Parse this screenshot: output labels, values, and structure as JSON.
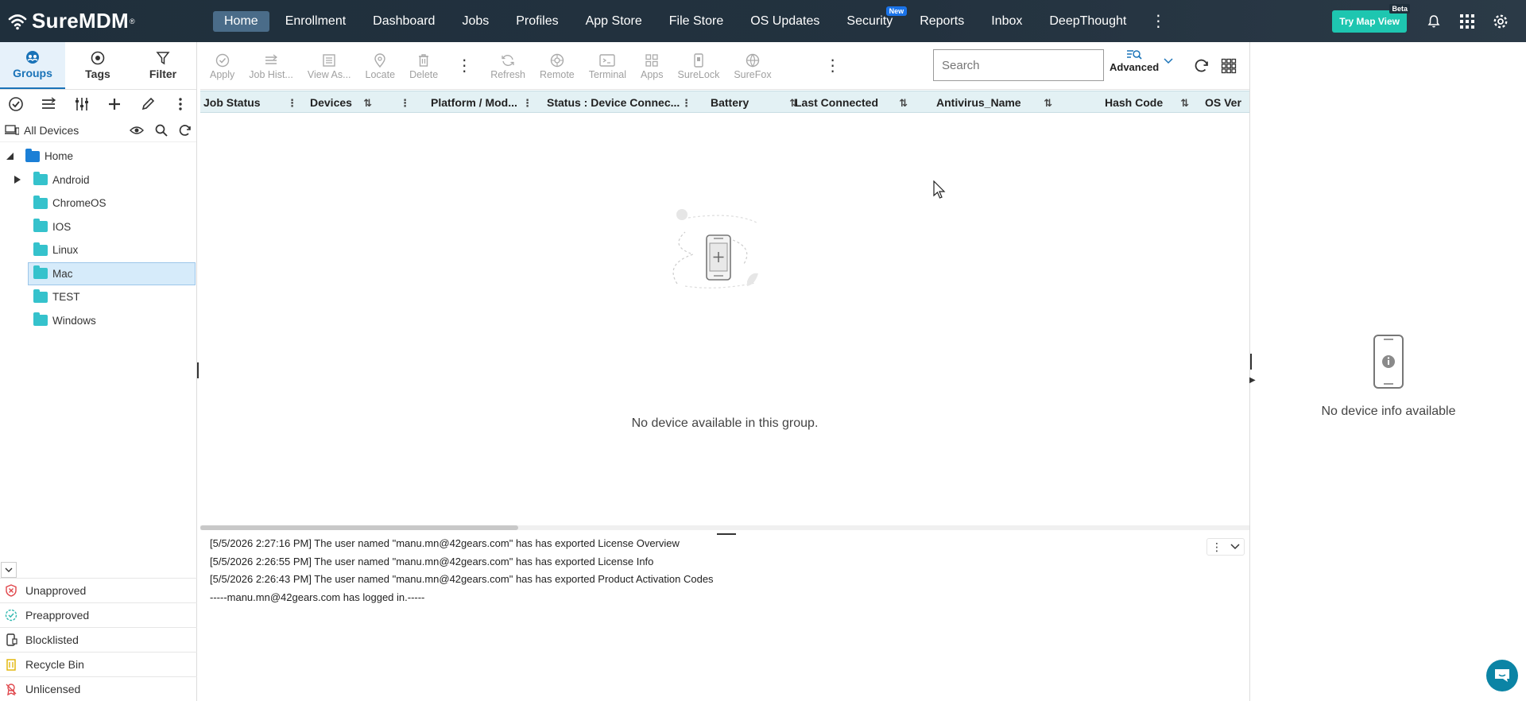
{
  "app": {
    "name": "SureMDM",
    "reg": "®"
  },
  "nav": {
    "items": [
      {
        "label": "Home",
        "active": true
      },
      {
        "label": "Enrollment"
      },
      {
        "label": "Dashboard"
      },
      {
        "label": "Jobs"
      },
      {
        "label": "Profiles"
      },
      {
        "label": "App Store"
      },
      {
        "label": "File Store"
      },
      {
        "label": "OS Updates"
      },
      {
        "label": "Security",
        "badge": "New"
      },
      {
        "label": "Reports"
      },
      {
        "label": "Inbox"
      },
      {
        "label": "DeepThought"
      }
    ],
    "more": "⋮",
    "try_map_view": "Try Map View",
    "beta": "Beta"
  },
  "left": {
    "tabs": [
      {
        "label": "Groups",
        "active": true
      },
      {
        "label": "Tags"
      },
      {
        "label": "Filter"
      }
    ],
    "all_devices": "All Devices",
    "tree": [
      {
        "label": "Home",
        "level": 0,
        "expanded": true,
        "color": "blue"
      },
      {
        "label": "Android",
        "level": 1,
        "has_children": true
      },
      {
        "label": "ChromeOS",
        "level": 1
      },
      {
        "label": "IOS",
        "level": 1
      },
      {
        "label": "Linux",
        "level": 1
      },
      {
        "label": "Mac",
        "level": 1,
        "selected": true
      },
      {
        "label": "TEST",
        "level": 1
      },
      {
        "label": "Windows",
        "level": 1
      }
    ],
    "bottom": [
      {
        "label": "Unapproved",
        "icon": "unapproved-icon"
      },
      {
        "label": "Preapproved",
        "icon": "preapproved-icon"
      },
      {
        "label": "Blocklisted",
        "icon": "blocklisted-icon"
      },
      {
        "label": "Recycle Bin",
        "icon": "recycle-bin-icon"
      },
      {
        "label": "Unlicensed",
        "icon": "unlicensed-icon"
      }
    ]
  },
  "toolbar": {
    "buttons": [
      "Apply",
      "Job Hist...",
      "View As...",
      "Locate",
      "Delete"
    ],
    "buttons2": [
      "Refresh",
      "Remote",
      "Terminal",
      "Apps",
      "SureLock",
      "SureFox"
    ],
    "more": "⋮",
    "search_placeholder": "Search",
    "advanced": "Advanced"
  },
  "grid": {
    "columns": [
      "Job Status",
      "Devices",
      "Platform / Mod...",
      "Status : Device Connec...",
      "Battery",
      "Last Connected",
      "Antivirus_Name",
      "Hash Code",
      "OS Ver"
    ],
    "empty_message": "No device available in this group."
  },
  "log": {
    "lines": [
      "[5/5/2026 2:27:16 PM] The user named \"manu.mn@42gears.com\" has has exported License Overview",
      "[5/5/2026 2:26:55 PM] The user named \"manu.mn@42gears.com\" has has exported License Info",
      "[5/5/2026 2:26:43 PM] The user named \"manu.mn@42gears.com\" has has exported Product Activation Codes",
      "-----manu.mn@42gears.com has logged in.-----"
    ]
  },
  "right": {
    "no_info": "No device info available"
  },
  "colors": {
    "topbar": "#1f2f3c",
    "accent": "#1a73b8",
    "map_button": "#1ec6b0",
    "grid_header": "#e3f1f4"
  }
}
